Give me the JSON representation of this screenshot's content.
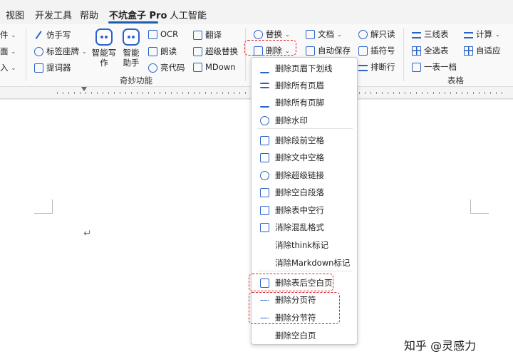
{
  "tabs": [
    {
      "label": "视图"
    },
    {
      "label": "开发工具"
    },
    {
      "label": "帮助"
    },
    {
      "label": "不坑盒子 Pro"
    },
    {
      "label": "人工智能"
    }
  ],
  "ribbon": {
    "left_cut": [
      "件",
      "面",
      "入"
    ],
    "col1": [
      "仿手写",
      "标签座牌",
      "提词器"
    ],
    "ai_write": "智能写作",
    "ai_helper_a": "智能",
    "ai_helper_b": "助手",
    "col3": [
      "OCR",
      "朗读",
      "亮代码"
    ],
    "col4": [
      "翻译",
      "超级替换",
      "MDown"
    ],
    "group_qimiao": "奇妙功能",
    "replace": "替换",
    "delete": "删除",
    "doc": "文档",
    "autosave": "自动保存",
    "read_lock": "解只读",
    "insert_num": "插符号",
    "sort_lines": "排断行",
    "table_col1": [
      "三线表",
      "全选表",
      "一表一档"
    ],
    "table_col2": [
      "计算",
      "自适应"
    ],
    "group_table": "表格"
  },
  "delete_menu": {
    "items": [
      {
        "label": "删除页眉下划线",
        "icon": "underline-icon"
      },
      {
        "label": "删除所有页眉",
        "icon": "header-icon"
      },
      {
        "label": "删除所有页脚",
        "icon": "footer-icon"
      },
      {
        "label": "删除水印",
        "icon": "watermark-icon"
      },
      {
        "label": "删除段前空格",
        "icon": "indent-icon"
      },
      {
        "label": "删除文中空格",
        "icon": "space-icon"
      },
      {
        "label": "删除超级链接",
        "icon": "link-icon"
      },
      {
        "label": "删除空白段落",
        "icon": "paragraph-icon"
      },
      {
        "label": "删除表中空行",
        "icon": "table-icon"
      },
      {
        "label": "消除混乱格式",
        "icon": "clear-format-icon"
      },
      {
        "label": "消除think标记",
        "icon": ""
      },
      {
        "label": "消除Markdown标记",
        "icon": ""
      },
      {
        "label": "删除表后空白页",
        "icon": "blank-page-icon"
      },
      {
        "label": "删除分页符",
        "icon": "page-break-icon"
      },
      {
        "label": "删除分节符",
        "icon": "section-break-icon"
      },
      {
        "label": "删除空白页",
        "icon": ""
      }
    ]
  },
  "watermark": "知乎 @灵感力",
  "colors": {
    "accent": "#2a63c8",
    "highlight": "#e0202a",
    "active_tab": "#1a5fb4"
  }
}
